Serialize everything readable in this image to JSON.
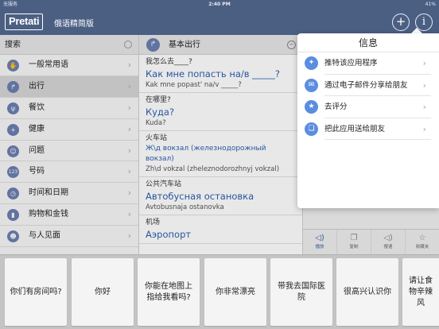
{
  "status": {
    "carrier": "无服务 ",
    "time": "2:40 PM",
    "battery": "41%"
  },
  "nav": {
    "logo": "Pretati",
    "title": "俄语精简版",
    "add_icon": "plus-icon",
    "info_icon": "info-icon"
  },
  "sidebar": {
    "search_label": "搜索",
    "items": [
      {
        "label": "一般常用语",
        "icon": "handshake-icon"
      },
      {
        "label": "出行",
        "icon": "arrow-turn-icon"
      },
      {
        "label": "餐饮",
        "icon": "fork-icon"
      },
      {
        "label": "健康",
        "icon": "health-icon"
      },
      {
        "label": "问题",
        "icon": "smiley-icon"
      },
      {
        "label": "号码",
        "icon": "numbers-icon"
      },
      {
        "label": "时间和日期",
        "icon": "clock-icon"
      },
      {
        "label": "购物和金钱",
        "icon": "shopping-icon"
      },
      {
        "label": "与人见面",
        "icon": "people-icon"
      }
    ]
  },
  "category": {
    "title": "基本出行"
  },
  "phrases": [
    {
      "zh": "我怎么去____?",
      "ru": "Как мне попасть на/в _____?",
      "tr": "Kak mne popast' na/v _____?"
    },
    {
      "zh": "在哪里?",
      "ru": "Куда?",
      "tr": "Kuda?"
    },
    {
      "zh": "火车站",
      "ru": "Ж\\д вокзал (железнодорожный вокзал)",
      "tr": "Zh\\d vokzal (zheleznodorozhnyj vokzal)"
    },
    {
      "zh": "公共汽车站",
      "ru": "Автобусная остановка",
      "tr": "Avtobusnaja ostanovka"
    },
    {
      "zh": "机场",
      "ru": "Аэропорт",
      "tr": ""
    }
  ],
  "toolbar": {
    "play": "播放",
    "copy": "复制",
    "slow": "慢速",
    "favorite": "收藏夹"
  },
  "popover": {
    "title": "信息",
    "items": [
      {
        "label": "推特该应用程序",
        "icon": "twitter-icon"
      },
      {
        "label": "通过电子邮件分享给朋友",
        "icon": "mail-icon"
      },
      {
        "label": "去评分",
        "icon": "star-icon"
      },
      {
        "label": "把此应用送给朋友",
        "icon": "gift-icon"
      }
    ]
  },
  "cards": [
    "你们有房间吗?",
    "你好",
    "你能在地图上指给我看吗?",
    "你非常漂亮",
    "带我去国际医院",
    "很高兴认识你",
    "请让食物辛辣风"
  ]
}
